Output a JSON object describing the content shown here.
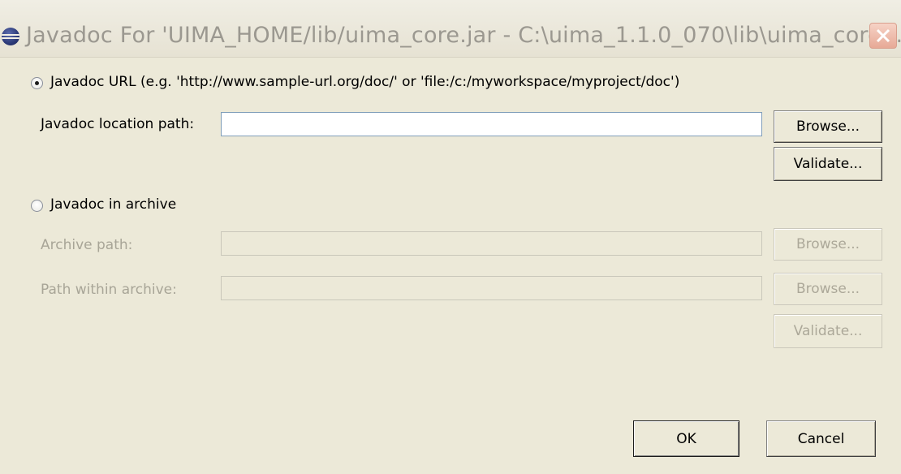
{
  "window": {
    "title": "Javadoc For 'UIMA_HOME/lib/uima_core.jar - C:\\uima_1.1.0_070\\lib\\uima_core...."
  },
  "url_option": {
    "radio_label": "Javadoc URL (e.g. 'http://www.sample-url.org/doc/' or 'file:/c:/myworkspace/myproject/doc')",
    "selected": true,
    "location_label": "Javadoc location path:",
    "location_value": "",
    "browse_label": "Browse...",
    "validate_label": "Validate..."
  },
  "archive_option": {
    "radio_label": "Javadoc in archive",
    "selected": false,
    "archive_path_label": "Archive path:",
    "archive_path_value": "",
    "archive_browse_label": "Browse...",
    "path_within_label": "Path within archive:",
    "path_within_value": "",
    "path_within_browse_label": "Browse...",
    "validate_label": "Validate..."
  },
  "footer": {
    "ok_label": "OK",
    "cancel_label": "Cancel"
  }
}
